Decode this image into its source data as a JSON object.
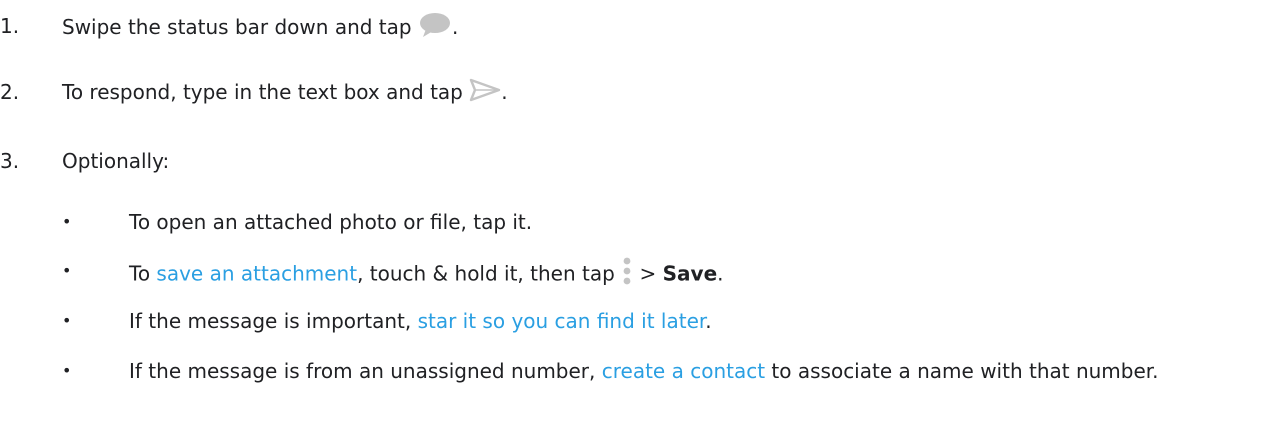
{
  "steps": [
    {
      "number": "1.",
      "before": "Swipe the status bar down and tap ",
      "icon": "message-bubble-icon",
      "after": "."
    },
    {
      "number": "2.",
      "before": "To respond, type in the text box and tap ",
      "icon": "send-icon",
      "after": "."
    },
    {
      "number": "3.",
      "text": "Optionally:"
    }
  ],
  "bullets": [
    {
      "marker": "•",
      "text": "To open an attached photo or file, tap it."
    },
    {
      "marker": "•",
      "before": "To ",
      "link": "save an attachment",
      "middle": ", touch & hold it, then tap ",
      "icon": "more-vert-icon",
      "sep": " > ",
      "bold": "Save",
      "after": "."
    },
    {
      "marker": "•",
      "before": "If the message is important, ",
      "link": "star it so you can find it later",
      "after": "."
    },
    {
      "marker": "•",
      "before": "If the message is from an unassigned number, ",
      "link": "create a contact",
      "after": " to associate a name with that number."
    }
  ],
  "colors": {
    "link": "#2a9fe2",
    "icon_gray": "#c4c4c4",
    "text": "#202124"
  }
}
